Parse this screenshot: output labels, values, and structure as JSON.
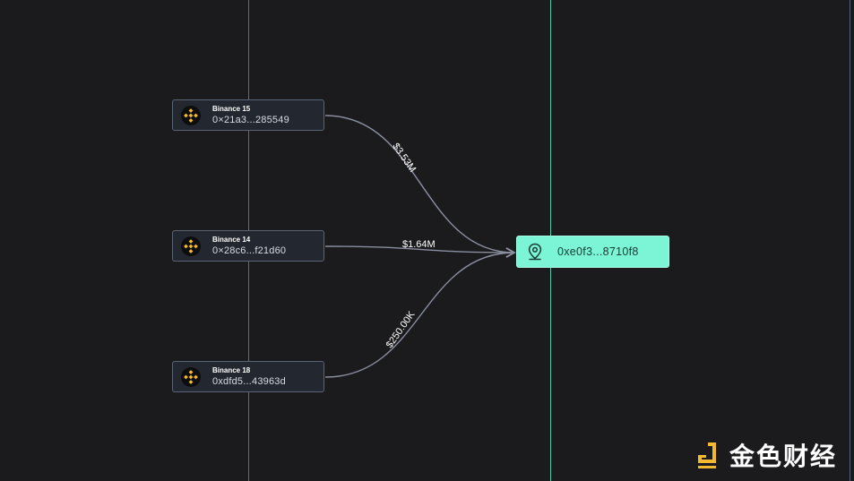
{
  "sources": [
    {
      "name": "Binance 15",
      "address": "0×21a3...285549",
      "icon": "binance-icon"
    },
    {
      "name": "Binance 14",
      "address": "0×28c6...f21d60",
      "icon": "binance-icon"
    },
    {
      "name": "Binance 18",
      "address": "0xdfd5...43963d",
      "icon": "binance-icon"
    }
  ],
  "target": {
    "address": "0xe0f3...8710f8",
    "icon": "location-pin-icon"
  },
  "flows": [
    {
      "label": "$3.53M"
    },
    {
      "label": "$1.64M"
    },
    {
      "label": "$250.00K"
    }
  ],
  "watermark": {
    "text": "金色财经",
    "icon": "jinse-logo-icon"
  },
  "colors": {
    "background": "#1b1b1d",
    "node": "#23272f",
    "target": "#7bf5d5",
    "binance": "#f3ba2f",
    "edge": "#8a8fa0",
    "watermark": "#f3ba2f"
  }
}
